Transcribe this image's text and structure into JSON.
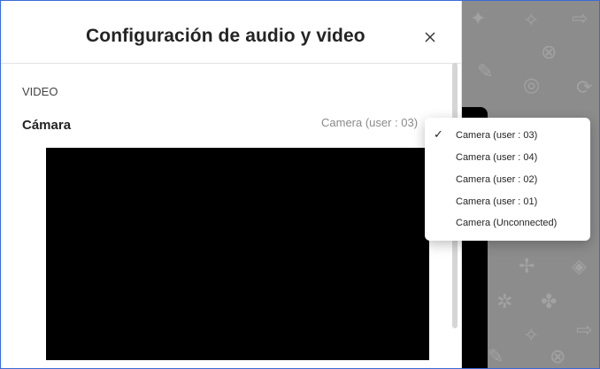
{
  "dialog": {
    "title": "Configuración de audio y video",
    "close_label": "×"
  },
  "video_section": {
    "label": "VIDEO",
    "camera_label": "Cámara",
    "camera_selected": "Camera (user : 03)"
  },
  "dropdown": {
    "options": [
      {
        "label": "Camera (user : 03)",
        "selected": true
      },
      {
        "label": "Camera (user : 04)",
        "selected": false
      },
      {
        "label": "Camera (user : 02)",
        "selected": false
      },
      {
        "label": "Camera (user : 01)",
        "selected": false
      },
      {
        "label": "Camera (Unconnected)",
        "selected": false
      }
    ],
    "check_mark": "✓"
  },
  "colors": {
    "frame_border": "#3b6bd6",
    "backdrop": "#8c8c8c",
    "preview": "#000000"
  }
}
